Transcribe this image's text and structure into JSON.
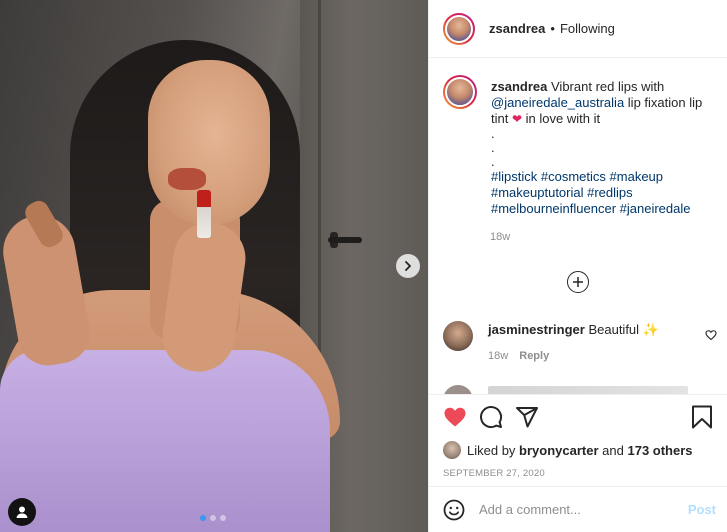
{
  "post": {
    "author": "zsandrea",
    "follow_status": "Following",
    "bullet": "•"
  },
  "caption": {
    "author": "zsandrea",
    "text_1": "Vibrant red lips with",
    "mention": "@janeiredale_australia",
    "text_2": "lip fixation lip tint",
    "heart": "❤",
    "text_3": "in love with it",
    "dot_1": ".",
    "dot_2": ".",
    "dot_3": ".",
    "hashtags": [
      "#lipstick",
      "#cosmetics",
      "#makeup",
      "#makeuptutorial",
      "#redlips",
      "#melbourneinfluencer",
      "#janeiredale"
    ],
    "age": "18w"
  },
  "comments": [
    {
      "author": "jasminestringer",
      "text": "Beautiful",
      "emoji": "✨",
      "age": "18w",
      "reply_label": "Reply"
    }
  ],
  "likes": {
    "prefix": "Liked by",
    "first_user": "bryonycarter",
    "and": "and",
    "others": "173 others"
  },
  "date": "SEPTEMBER 27, 2020",
  "add_comment": {
    "placeholder": "Add a comment...",
    "post_label": "Post"
  },
  "carousel": {
    "count": 3,
    "active_index": 0
  },
  "colors": {
    "like_red": "#ed4956",
    "link_blue": "#00376b",
    "post_disabled": "#b2dffc",
    "carousel_active": "#3897f0"
  },
  "icons": [
    "heart-icon",
    "comment-icon",
    "share-icon",
    "bookmark-icon",
    "emoji-icon",
    "chevron-right-icon",
    "user-tag-icon",
    "add-circle-icon"
  ]
}
